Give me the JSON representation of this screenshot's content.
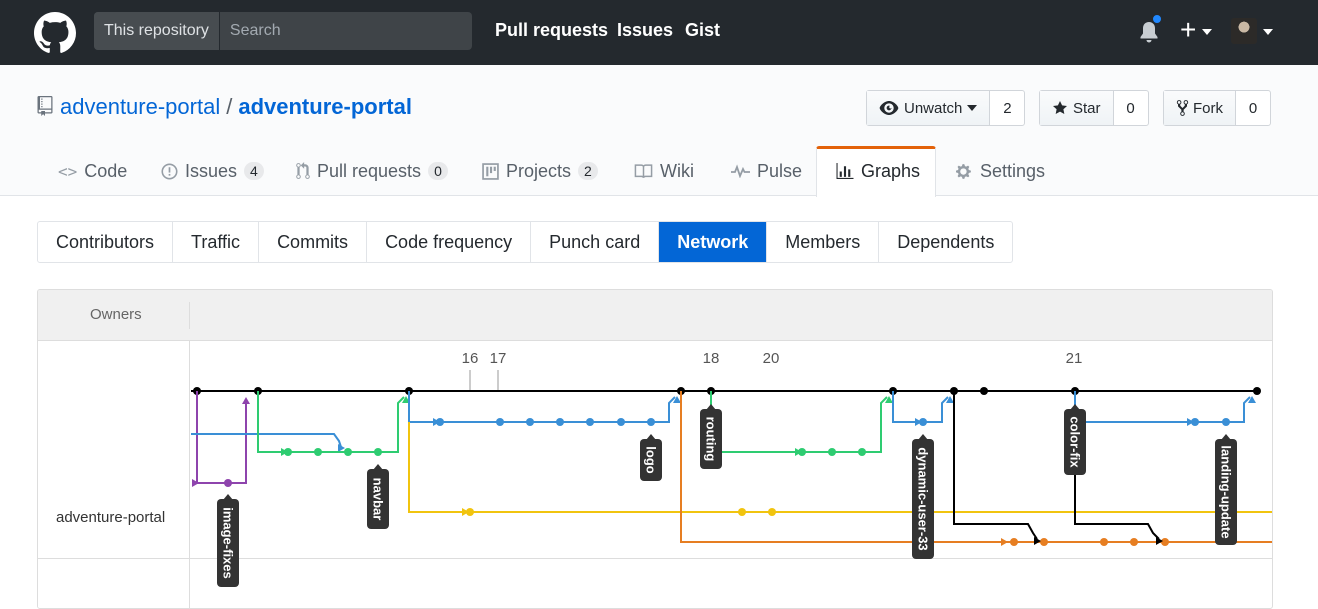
{
  "header": {
    "search_scope": "This repository",
    "search_placeholder": "Search",
    "nav": [
      "Pull requests",
      "Issues",
      "Gist"
    ]
  },
  "repo": {
    "owner": "adventure-portal",
    "separator": "/",
    "name": "adventure-portal",
    "watch_label": "Unwatch",
    "watch_count": "2",
    "star_label": "Star",
    "star_count": "0",
    "fork_label": "Fork",
    "fork_count": "0"
  },
  "reponav": {
    "code": "Code",
    "issues": "Issues",
    "issues_count": "4",
    "pulls": "Pull requests",
    "pulls_count": "0",
    "projects": "Projects",
    "projects_count": "2",
    "wiki": "Wiki",
    "pulse": "Pulse",
    "graphs": "Graphs",
    "settings": "Settings"
  },
  "subnav": {
    "contributors": "Contributors",
    "traffic": "Traffic",
    "commits": "Commits",
    "code_frequency": "Code frequency",
    "punch_card": "Punch card",
    "network": "Network",
    "members": "Members",
    "dependents": "Dependents"
  },
  "network": {
    "owners_label": "Owners",
    "owner": "adventure-portal",
    "dates": [
      "16",
      "17",
      "18",
      "20",
      "21"
    ],
    "branch_labels": [
      "image-fixes",
      "navbar",
      "logo",
      "routing",
      "dynamic-user-33",
      "color-fix",
      "landing-update"
    ],
    "colors": {
      "master": "#000000",
      "blue": "#3a8fd6",
      "green": "#2ecc71",
      "purple": "#8e44ad",
      "yellow": "#f1c40f",
      "orange": "#e67e22"
    }
  }
}
